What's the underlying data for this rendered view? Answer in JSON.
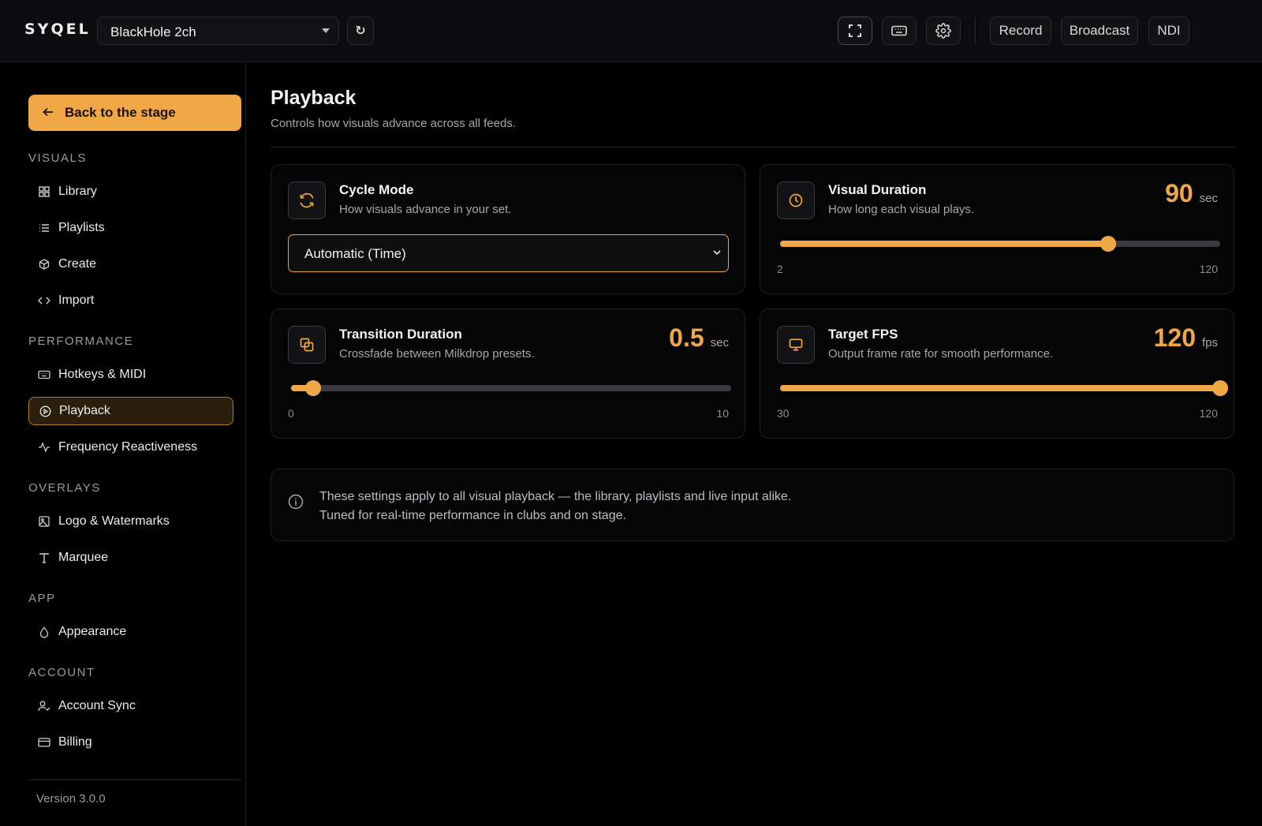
{
  "app": {
    "logo": "SYQEL"
  },
  "topbar": {
    "device_label": "BlackHole 2ch",
    "refresh_glyph": "↻",
    "buttons": {
      "record": "Record",
      "broadcast": "Broadcast",
      "ndi": "NDI"
    }
  },
  "sidebar": {
    "back_label": "Back to the stage",
    "sections": {
      "visuals": "VISUALS",
      "performance": "PERFORMANCE",
      "overlays": "OVERLAYS",
      "app": "APP",
      "account": "ACCOUNT"
    },
    "items": {
      "library": "Library",
      "playlists": "Playlists",
      "create": "Create",
      "import": "Import",
      "hotkeys": "Hotkeys & MIDI",
      "playback": "Playback",
      "frequency": "Frequency Reactiveness",
      "logo": "Logo & Watermarks",
      "marquee": "Marquee",
      "appearance": "Appearance",
      "account_sync": "Account Sync",
      "billing": "Billing"
    },
    "active_item": "playback",
    "version": "Version 3.0.0"
  },
  "page": {
    "title": "Playback",
    "subtitle": "Controls how visuals advance across all feeds."
  },
  "cards": {
    "cycle_mode": {
      "title": "Cycle Mode",
      "desc": "How visuals advance in your set.",
      "selected": "Automatic (Time)"
    },
    "visual_duration": {
      "title": "Visual Duration",
      "desc": "How long each visual plays.",
      "value": 90,
      "value_text": "90",
      "unit": "sec",
      "min": 2,
      "max": 120,
      "min_text": "2",
      "max_text": "120"
    },
    "transition_duration": {
      "title": "Transition Duration",
      "desc": "Crossfade between Milkdrop presets.",
      "value": 0.5,
      "value_text": "0.5",
      "unit": "sec",
      "min": 0,
      "max": 10,
      "min_text": "0",
      "max_text": "10"
    },
    "target_fps": {
      "title": "Target FPS",
      "desc": "Output frame rate for smooth performance.",
      "value": 120,
      "value_text": "120",
      "unit": "fps",
      "min": 30,
      "max": 120,
      "min_text": "30",
      "max_text": "120"
    }
  },
  "info": {
    "line1": "These settings apply to all visual playback — the library, playlists and live input alike.",
    "line2": "Tuned for real-time performance in clubs and on stage."
  },
  "colors": {
    "accent": "#f0a847",
    "background": "#000000",
    "surface": "#0c0c0e",
    "active_bg": "#2a1e0c"
  }
}
